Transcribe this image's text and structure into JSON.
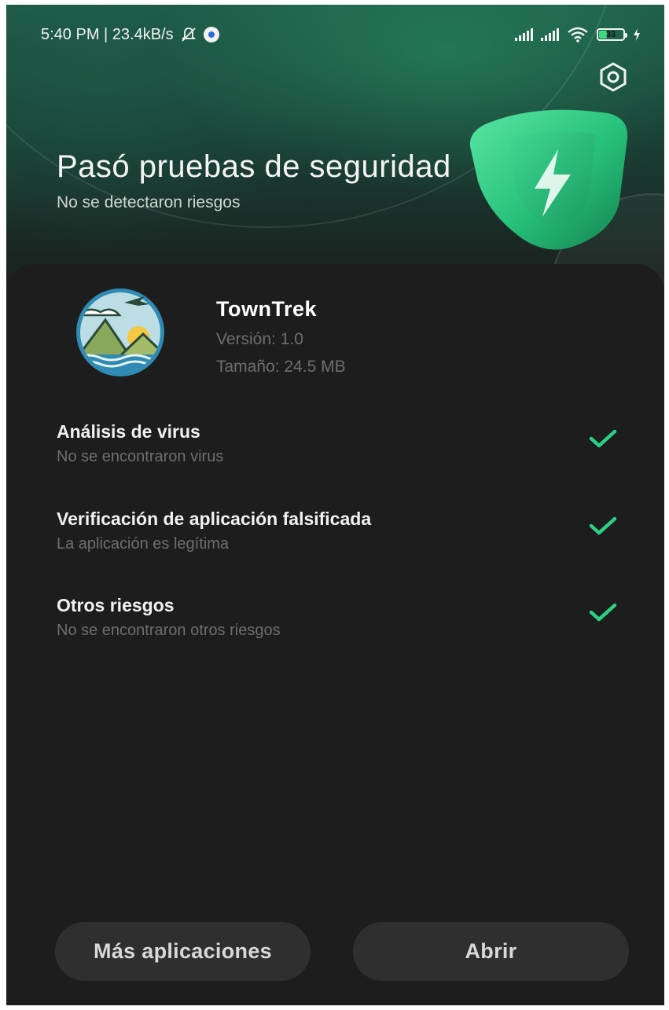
{
  "status_bar": {
    "time_speed": "5:40 PM | 23.4kB/s",
    "battery_level": "33",
    "icons": [
      "notifications-muted-icon",
      "app-notification-icon",
      "signal-icon",
      "signal-icon",
      "wifi-icon",
      "battery-icon",
      "charging-icon"
    ]
  },
  "header": {
    "title": "Pasó pruebas de seguridad",
    "subtitle": "No se detectaron riesgos",
    "settings_icon": "settings-icon",
    "shield_icon": "shield-lightning-icon"
  },
  "app": {
    "name": "TownTrek",
    "version": "Versión: 1.0",
    "size": "Tamaño: 24.5 MB"
  },
  "checks": [
    {
      "title": "Análisis de virus",
      "subtitle": "No se encontraron virus",
      "status": "passed"
    },
    {
      "title": "Verificación de aplicación falsificada",
      "subtitle": "La aplicación es legítima",
      "status": "passed"
    },
    {
      "title": "Otros riesgos",
      "subtitle": "No se encontraron otros riesgos",
      "status": "passed"
    }
  ],
  "buttons": {
    "more_apps": "Más aplicaciones",
    "open": "Abrir"
  },
  "colors": {
    "accent_green": "#2bd184",
    "background": "#1b1b1b",
    "button_bg": "#2f2f2f",
    "secondary_text": "#6e6e6e"
  }
}
